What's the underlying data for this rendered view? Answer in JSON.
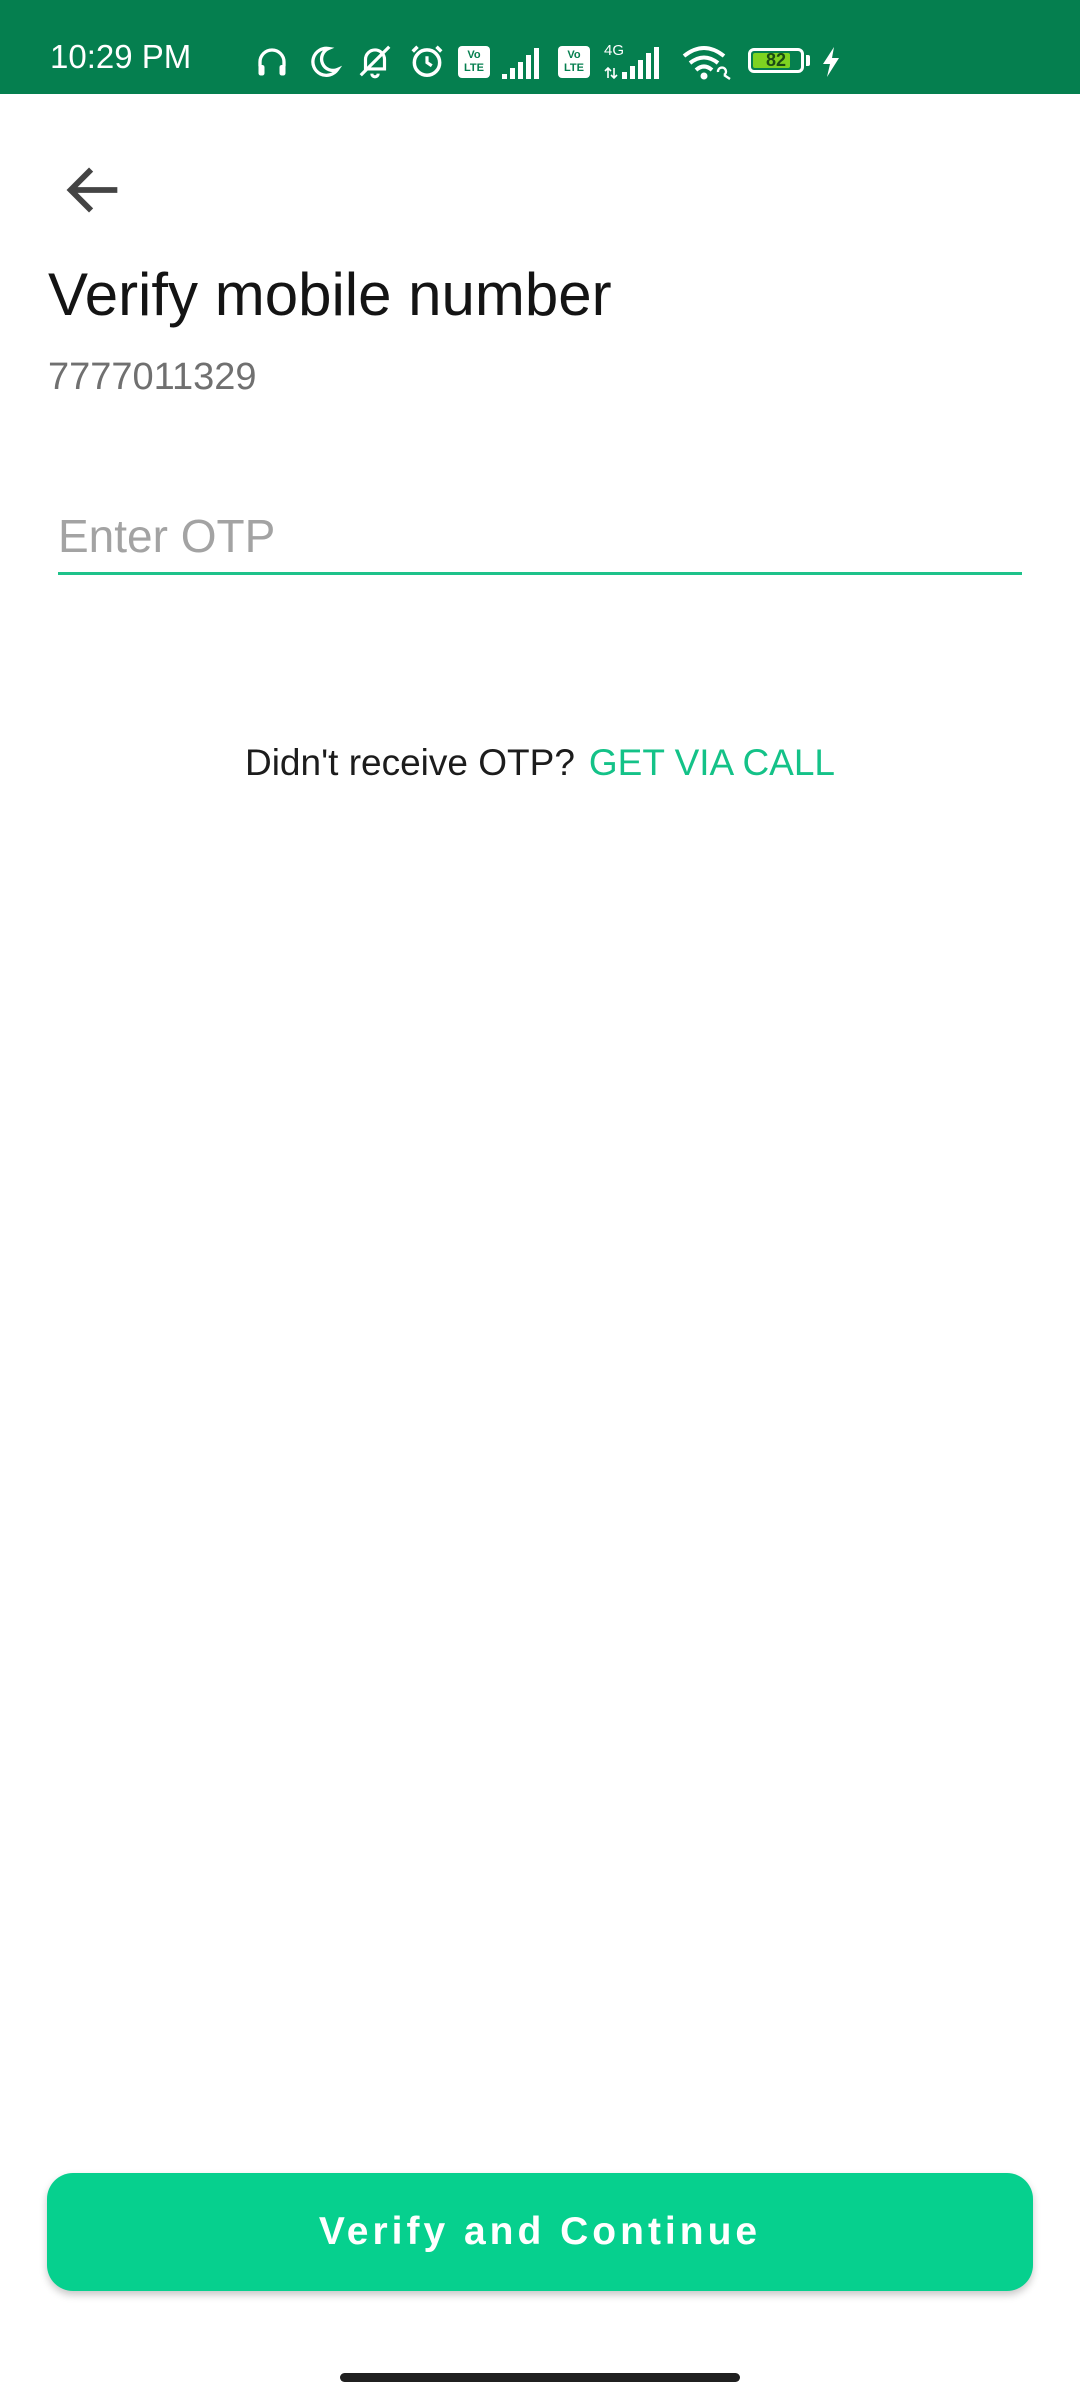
{
  "status_bar": {
    "time": "10:29 PM",
    "network_label": "4G",
    "volte_label": "Vo",
    "lte_label": "LTE",
    "battery_percent": "82",
    "battery_level": 0.82,
    "background_color": "#057f4f",
    "icons": [
      "headphones-icon",
      "moon-icon",
      "alarm-off-icon",
      "alarm-icon",
      "volte-icon",
      "signal-icon",
      "volte-icon",
      "signal-4g-icon",
      "wifi-icon",
      "battery-icon",
      "charging-icon"
    ]
  },
  "header": {
    "back_icon": "arrow-left-icon",
    "title": "Verify mobile number",
    "phone_number": "7777011329"
  },
  "otp": {
    "value": "",
    "placeholder": "Enter OTP",
    "underline_color": "#1ec28a"
  },
  "resend": {
    "prompt": "Didn't receive OTP?",
    "link_label": "GET VIA CALL",
    "link_color": "#14c288"
  },
  "footer": {
    "verify_label": "Verify and Continue",
    "button_color": "#06d08e"
  }
}
